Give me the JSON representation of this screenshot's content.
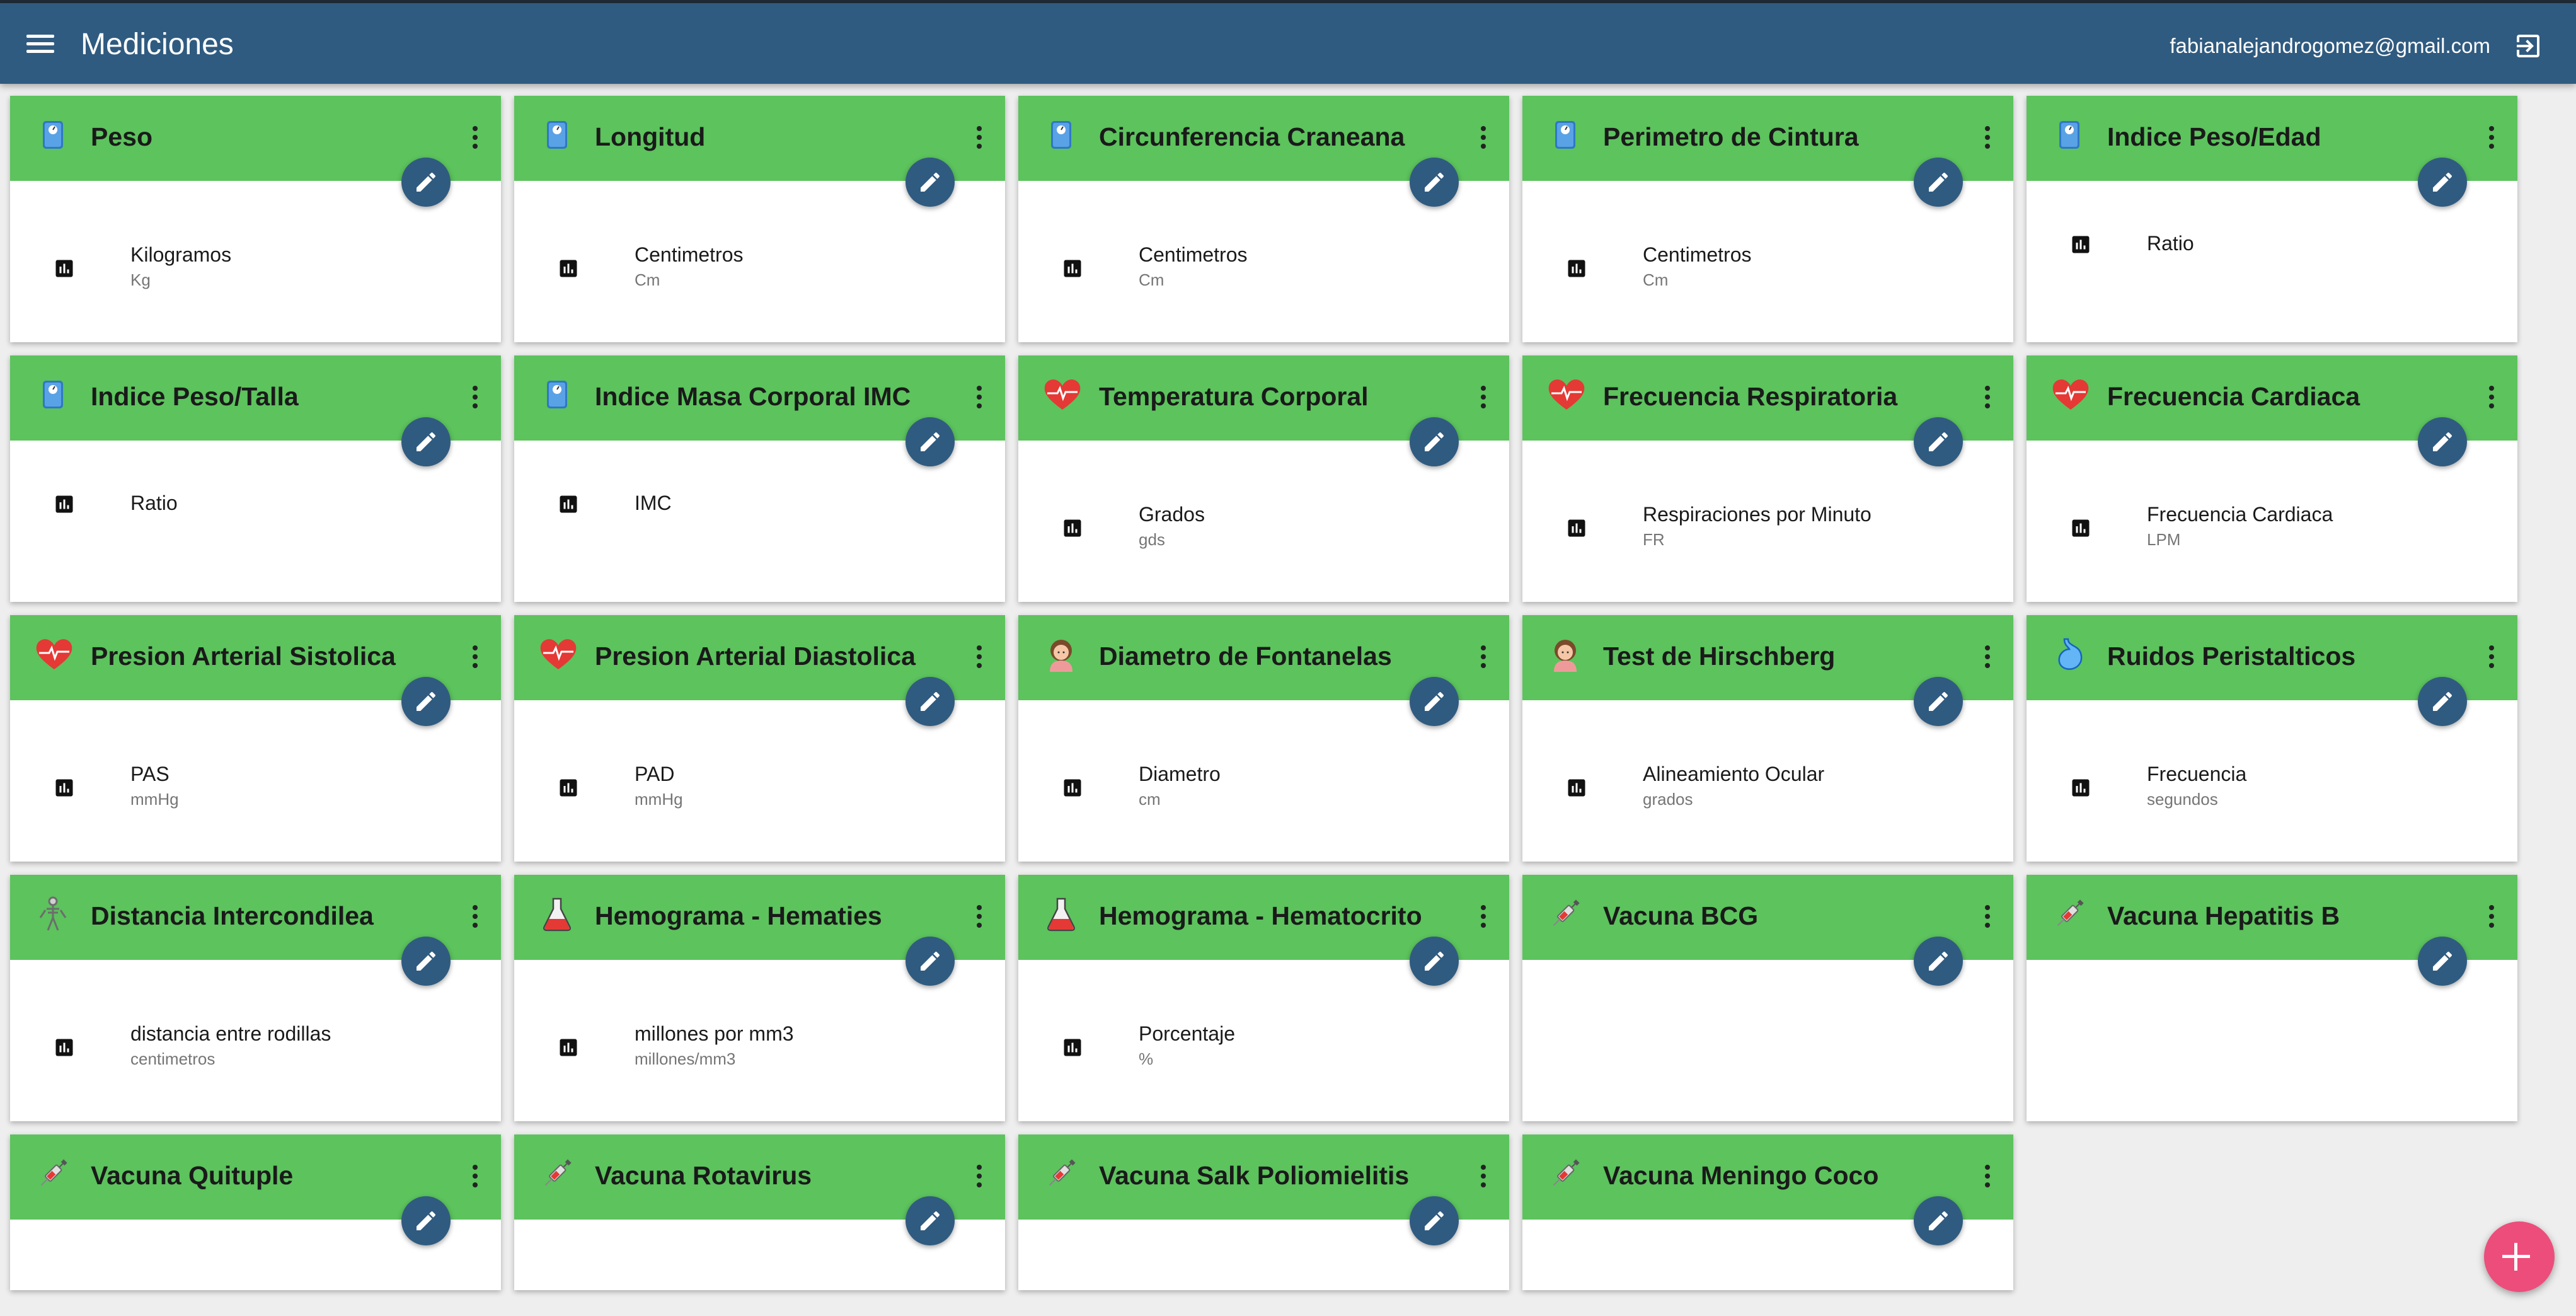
{
  "app": {
    "title": "Mediciones",
    "user_email": "fabianalejandrogomez@gmail.com"
  },
  "colors": {
    "appbar": "#305b80",
    "card_header": "#5cc35d",
    "fab": "#ed4d7b",
    "background": "#eeeeee"
  },
  "cards": [
    {
      "title": "Peso",
      "icon": "scale-icon",
      "measure": {
        "name": "Kilogramos",
        "unit": "Kg"
      }
    },
    {
      "title": "Longitud",
      "icon": "scale-icon",
      "measure": {
        "name": "Centimetros",
        "unit": "Cm"
      }
    },
    {
      "title": "Circunferencia Craneana",
      "icon": "scale-icon",
      "measure": {
        "name": "Centimetros",
        "unit": "Cm"
      }
    },
    {
      "title": "Perimetro de Cintura",
      "icon": "scale-icon",
      "measure": {
        "name": "Centimetros",
        "unit": "Cm"
      }
    },
    {
      "title": "Indice Peso/Edad",
      "icon": "scale-icon",
      "measure": {
        "name": "Ratio",
        "unit": ""
      }
    },
    {
      "title": "Indice Peso/Talla",
      "icon": "scale-icon",
      "measure": {
        "name": "Ratio",
        "unit": ""
      }
    },
    {
      "title": "Indice Masa Corporal IMC",
      "icon": "scale-icon",
      "measure": {
        "name": "IMC",
        "unit": ""
      }
    },
    {
      "title": "Temperatura Corporal",
      "icon": "heart-icon",
      "measure": {
        "name": "Grados",
        "unit": "gds"
      }
    },
    {
      "title": "Frecuencia Respiratoria",
      "icon": "heart-icon",
      "measure": {
        "name": "Respiraciones por Minuto",
        "unit": "FR"
      }
    },
    {
      "title": "Frecuencia Cardiaca",
      "icon": "heart-icon",
      "measure": {
        "name": "Frecuencia Cardiaca",
        "unit": "LPM"
      }
    },
    {
      "title": "Presion Arterial Sistolica",
      "icon": "heart-icon",
      "measure": {
        "name": "PAS",
        "unit": "mmHg"
      }
    },
    {
      "title": "Presion Arterial Diastolica",
      "icon": "heart-icon",
      "measure": {
        "name": "PAD",
        "unit": "mmHg"
      }
    },
    {
      "title": "Diametro de Fontanelas",
      "icon": "baby-icon",
      "measure": {
        "name": "Diametro",
        "unit": "cm"
      }
    },
    {
      "title": "Test de Hirschberg",
      "icon": "baby-icon",
      "measure": {
        "name": "Alineamiento Ocular",
        "unit": "grados"
      }
    },
    {
      "title": "Ruidos Peristalticos",
      "icon": "stomach-icon",
      "measure": {
        "name": "Frecuencia",
        "unit": "segundos"
      }
    },
    {
      "title": "Distancia Intercondilea",
      "icon": "skeleton-icon",
      "measure": {
        "name": "distancia entre rodillas",
        "unit": "centimetros"
      }
    },
    {
      "title": "Hemograma - Hematies",
      "icon": "flask-icon",
      "measure": {
        "name": "millones por mm3",
        "unit": "millones/mm3"
      }
    },
    {
      "title": "Hemograma - Hematocrito",
      "icon": "flask-icon",
      "measure": {
        "name": "Porcentaje",
        "unit": "%"
      }
    },
    {
      "title": "Vacuna BCG",
      "icon": "syringe-icon",
      "measure": null
    },
    {
      "title": "Vacuna Hepatitis B",
      "icon": "syringe-icon",
      "measure": null
    },
    {
      "title": "Vacuna Quituple",
      "icon": "syringe-icon",
      "measure": null,
      "short": true
    },
    {
      "title": "Vacuna Rotavirus",
      "icon": "syringe-icon",
      "measure": null,
      "short": true
    },
    {
      "title": "Vacuna Salk Poliomielitis",
      "icon": "syringe-icon",
      "measure": null,
      "short": true
    },
    {
      "title": "Vacuna Meningo Coco",
      "icon": "syringe-icon",
      "measure": null,
      "short": true
    }
  ]
}
